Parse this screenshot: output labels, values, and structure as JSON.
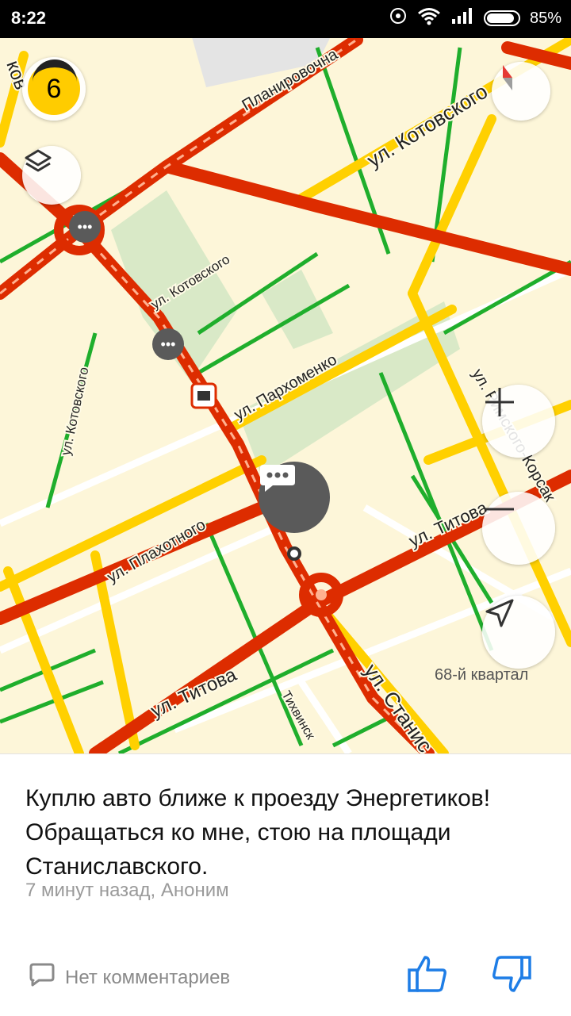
{
  "status_bar": {
    "time": "8:22",
    "battery": "85%",
    "icons": [
      "hotspot-icon",
      "wifi-icon",
      "signal-icon",
      "battery-icon"
    ]
  },
  "map": {
    "street_labels": {
      "planirovochnaya": "Планировочна",
      "kotovskogo_1": "ул. Котовского",
      "kotovskogo_2": "ул. Котовского",
      "kotovskogo_3": "ул. Котовского",
      "kotovskogo_edge": "ков",
      "parkhomenko": "ул. Пархоменко",
      "rimsky": "ул. Римского-Корсак",
      "titova_1": "ул. Титова",
      "titova_2": "ул. Титова",
      "plakhotnogo": "ул. Плахотного",
      "stanislavskogo": "ул. Станис",
      "tikhvinskaya": "Тихвинск"
    },
    "quarter_label": "68-й квартал",
    "notification_count": "6",
    "traffic_colors": {
      "jam": "#dd2c00",
      "slow": "#ffd000",
      "free": "#1fae2c"
    }
  },
  "controls": {
    "layers_icon": "layers-icon",
    "compass_icon": "compass-icon",
    "zoom_in_icon": "plus-icon",
    "zoom_out_icon": "minus-icon",
    "locate_icon": "location-arrow-icon"
  },
  "post": {
    "text": "Куплю авто ближе к проезду Энергетиков! Обращаться ко мне, стою на площади Станиславского.",
    "meta": "7 минут назад, Аноним",
    "comments_label": "Нет комментариев"
  }
}
